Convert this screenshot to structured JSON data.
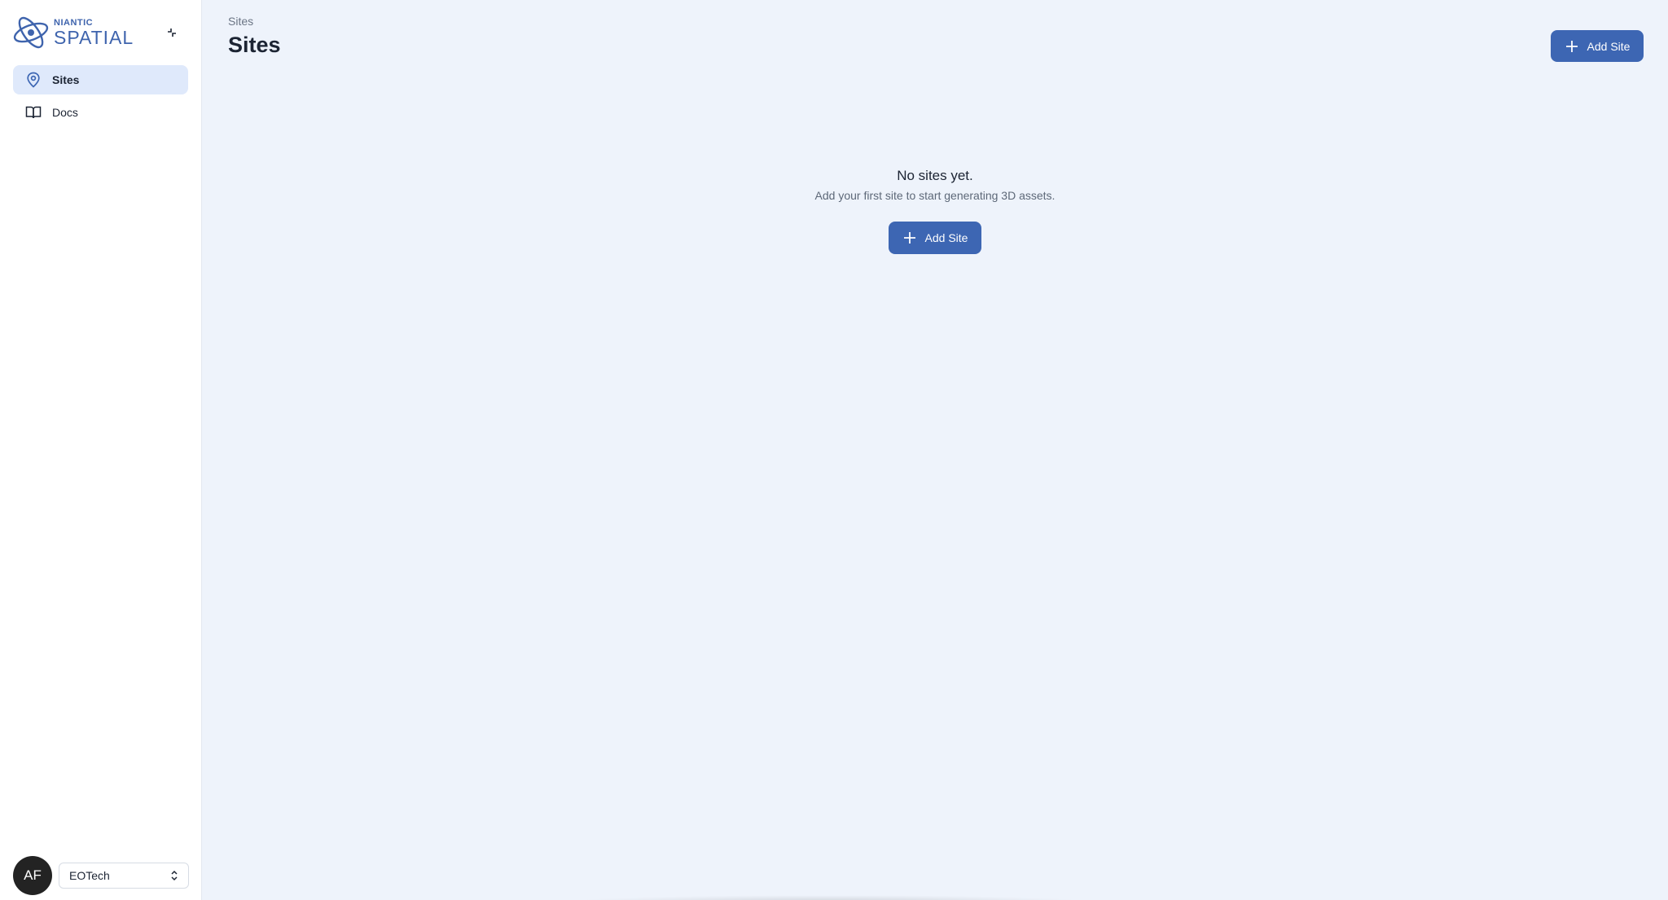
{
  "brand": {
    "top": "NIANTIC",
    "bottom": "SPATIAL",
    "color": "#3f64ad"
  },
  "sidebar": {
    "items": [
      {
        "label": "Sites",
        "icon": "map-pin-icon",
        "active": true
      },
      {
        "label": "Docs",
        "icon": "book-open-icon",
        "active": false
      }
    ],
    "collapse_icon": "collapse-icon"
  },
  "user": {
    "initials": "AF"
  },
  "org_select": {
    "value": "EOTech",
    "icon": "chevron-up-down-icon"
  },
  "header": {
    "breadcrumb": "Sites",
    "title": "Sites",
    "add_button_label": "Add Site"
  },
  "empty_state": {
    "title": "No sites yet.",
    "subtitle": "Add your first site to start generating 3D assets.",
    "button_label": "Add Site"
  },
  "colors": {
    "primary": "#3d66b3",
    "active_nav": "#dfe9fb",
    "background": "#eef3fb"
  }
}
